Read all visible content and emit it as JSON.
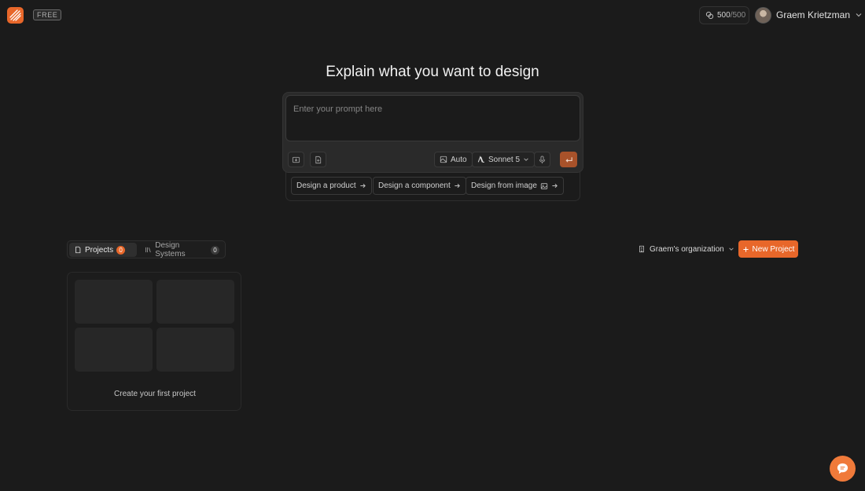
{
  "header": {
    "logo_icon": "stripes-logo-icon",
    "plan_badge": "FREE",
    "credits": {
      "used": "500",
      "total": "/500",
      "icon": "link-coins-icon"
    },
    "user": {
      "name": "Graem Krietzman",
      "avatar": "user-avatar"
    }
  },
  "hero": {
    "title": "Explain what you want to design",
    "prompt_placeholder": "Enter your prompt here",
    "toolbar": {
      "mode_label": "Auto",
      "model_label": "Sonnet 5"
    },
    "suggestions": [
      {
        "label": "Design a product"
      },
      {
        "label": "Design a component"
      },
      {
        "label": "Design from image"
      }
    ]
  },
  "projects_bar": {
    "tabs": [
      {
        "label": "Projects",
        "count": "0"
      },
      {
        "label": "Design Systems",
        "count": "0"
      }
    ],
    "organization": "Graem's organization",
    "new_project_label": "New Project"
  },
  "empty_state": {
    "text": "Create your first project"
  },
  "colors": {
    "accent": "#e8672a",
    "background": "#1b1b1b",
    "send_button": "#a8522a"
  }
}
